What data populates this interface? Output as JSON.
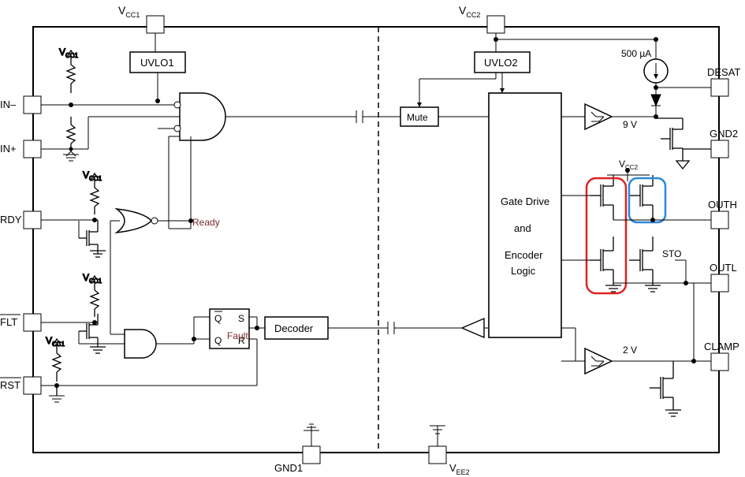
{
  "pins_left": [
    "IN–",
    "IN+",
    "RDY",
    "FLT",
    "RST"
  ],
  "pins_right": [
    "DESAT",
    "GND2",
    "OUTH",
    "OUTL",
    "CLAMP"
  ],
  "pins_top": {
    "vcc1": "V",
    "vcc1_sub": "CC1",
    "vcc2": "V",
    "vcc2_sub": "CC2"
  },
  "pins_bottom": {
    "gnd1": "GND1",
    "vee2": "V",
    "vee2_sub": "EE2"
  },
  "blocks": {
    "uvlo1": "UVLO1",
    "uvlo2": "UVLO2",
    "mute": "Mute",
    "decoder": "Decoder",
    "gate_l1": "Gate Drive",
    "gate_l2": "and",
    "gate_l3": "Encoder",
    "gate_l4": "Logic",
    "sto": "STO"
  },
  "flags": {
    "q": "Q",
    "qb": "Q",
    "s": "S",
    "r": "R",
    "ready": "Ready",
    "fault": "Fault"
  },
  "values": {
    "i_src": "500 µA",
    "v9": "9 V",
    "v2": "2 V"
  },
  "labels": {
    "vcc1_res": "V",
    "vcc1_res_sub": "CC1",
    "vcc2_lbl": "V",
    "vcc2_lbl_sub": "CC2"
  },
  "chart_data": {
    "type": "block-diagram",
    "description": "Isolated gate driver functional block diagram",
    "left_side_supply": "VCC1",
    "right_side_supply": "VCC2",
    "isolation_barrier": "dashed vertical line between primary and secondary",
    "primary_blocks": [
      "UVLO1",
      "Input logic (AND/NOR gates)",
      "SR latch",
      "Decoder"
    ],
    "secondary_blocks": [
      "UVLO2",
      "Mute",
      "Gate Drive and Encoder Logic",
      "Output driver MOSFET stages",
      "DESAT comparator 9V",
      "CLAMP comparator 2V",
      "500µA current source"
    ],
    "inputs": [
      "IN-",
      "IN+",
      "RDY",
      "FLT",
      "RST"
    ],
    "outputs": [
      "DESAT",
      "GND2",
      "OUTH",
      "STO",
      "OUTL",
      "CLAMP"
    ],
    "thresholds": {
      "desat_comparator_V": 9,
      "clamp_comparator_V": 2,
      "desat_current_uA": 500
    },
    "internal_signals": [
      "Ready",
      "Fault"
    ],
    "highlight_boxes": [
      {
        "color": "red",
        "around": "OUTH high-side + low-side pair"
      },
      {
        "color": "blue",
        "around": "OUTH high-side MOSFET"
      }
    ]
  }
}
